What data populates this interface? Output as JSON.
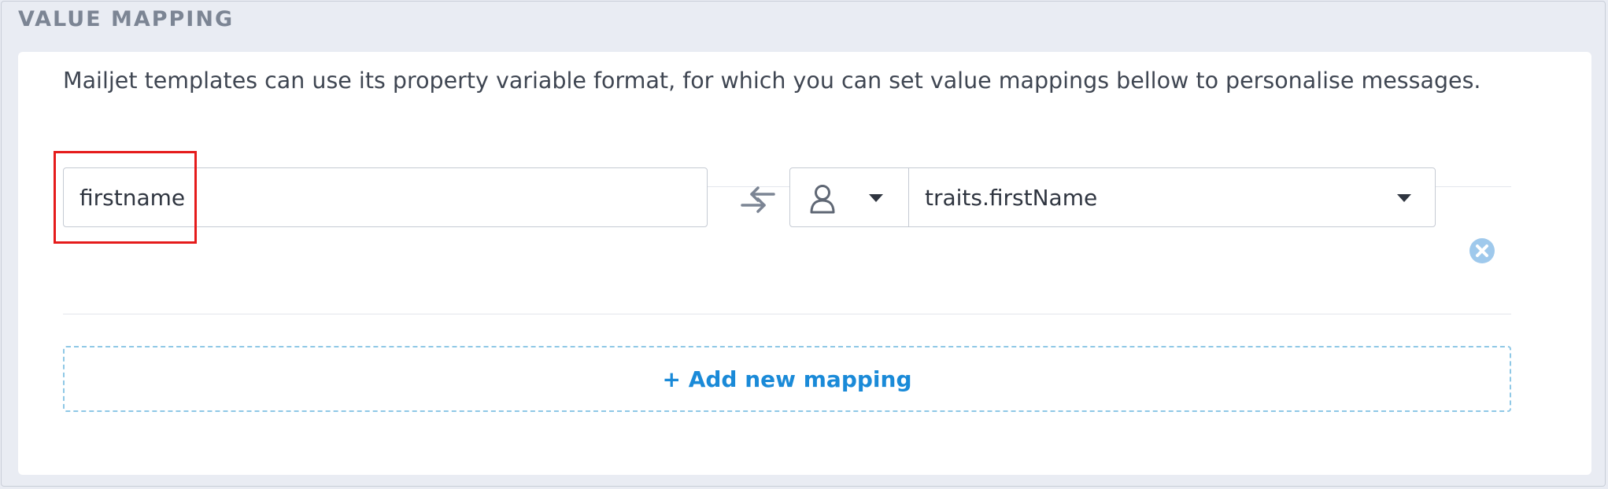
{
  "section": {
    "title": "VALUE MAPPING"
  },
  "description": "Mailjet templates can use its property variable format, for which you can set value mappings bellow to personalise messages.",
  "mapping": {
    "key_value": "firstname",
    "source_type_icon": "user-icon",
    "value_select": "traits.firstName"
  },
  "add_mapping_label": "+ Add new mapping",
  "colors": {
    "accent": "#1a8ad8",
    "remove": "#9fc9ec",
    "highlight": "#e51b1b"
  }
}
